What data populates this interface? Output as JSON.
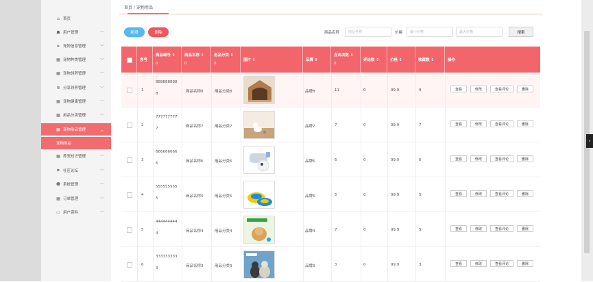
{
  "sidebar": {
    "items": [
      {
        "label": "首页",
        "icon": "home-icon",
        "glyph": "⌂",
        "chevron": false
      },
      {
        "label": "用户管理",
        "icon": "user-group-icon",
        "glyph": "☗",
        "chevron": true
      },
      {
        "label": "宠物信息管理",
        "icon": "paper-plane-icon",
        "glyph": "➤",
        "chevron": true
      },
      {
        "label": "宠物种类管理",
        "icon": "grid-icon",
        "glyph": "▦",
        "chevron": true
      },
      {
        "label": "宠物领养管理",
        "icon": "grid-icon",
        "glyph": "▦",
        "chevron": true
      },
      {
        "label": "分享领养管理",
        "icon": "database-icon",
        "glyph": "≣",
        "chevron": true
      },
      {
        "label": "宠物健康管理",
        "icon": "grid-icon",
        "glyph": "▦",
        "chevron": true
      },
      {
        "label": "用品分类管理",
        "icon": "grid-icon",
        "glyph": "▦",
        "chevron": true
      },
      {
        "label": "宠物用品管理",
        "icon": "grid-icon",
        "glyph": "▦",
        "chevron": true,
        "active": true
      },
      {
        "label": "养宠知识管理",
        "icon": "grid-icon",
        "glyph": "▦",
        "chevron": true
      },
      {
        "label": "社区论坛",
        "icon": "flag-icon",
        "glyph": "⚑",
        "chevron": true
      },
      {
        "label": "系统管理",
        "icon": "user-icon",
        "glyph": "☻",
        "chevron": true
      },
      {
        "label": "订单管理",
        "icon": "grid-icon",
        "glyph": "▦",
        "chevron": true
      },
      {
        "label": "用户资料",
        "icon": "id-card-icon",
        "glyph": "▭",
        "chevron": true
      }
    ],
    "sub_item": "宠物用品"
  },
  "breadcrumb": "首页 / 宠物用品",
  "toolbar": {
    "add_label": "新增",
    "delete_label": "删除",
    "search_label": "搜索"
  },
  "search": {
    "name_label": "商品名称",
    "name_placeholder": "商品名称",
    "price_label": "价格",
    "min_placeholder": "最小价格",
    "max_placeholder": "最大价格"
  },
  "table": {
    "headers": {
      "index": "序号",
      "code": "商品编号",
      "name": "商品名称",
      "category": "用品分类",
      "image": "图片",
      "brand": "品牌",
      "clicks": "点击次数",
      "comments": "评论数",
      "price": "价格",
      "favorites": "收藏数",
      "actions": "操作",
      "sort_mark": "0",
      "sort_arrow": "⇕"
    },
    "action_labels": {
      "view": "查看",
      "edit": "修改",
      "view_comments": "查看评论",
      "delete": "删除"
    },
    "rows": [
      {
        "index": "1",
        "code_line1": "888888888",
        "code_line2": "8",
        "name": "商品名称8",
        "category": "用品分类8",
        "brand": "品牌8",
        "clicks": "11",
        "comments": "0",
        "price": "99.9",
        "favorites": "9",
        "image": "pet-house"
      },
      {
        "index": "2",
        "code_line1": "777777777",
        "code_line2": "7",
        "name": "商品名称7",
        "category": "用品分类7",
        "brand": "品牌7",
        "clicks": "7",
        "comments": "0",
        "price": "99.9",
        "favorites": "7",
        "image": "dog-on-floor"
      },
      {
        "index": "3",
        "code_line1": "666666666",
        "code_line2": "6",
        "name": "商品名称6",
        "category": "用品分类6",
        "brand": "品牌6",
        "clicks": "6",
        "comments": "0",
        "price": "99.9",
        "favorites": "6",
        "image": "grooming-brush"
      },
      {
        "index": "4",
        "code_line1": "555555555",
        "code_line2": "5",
        "name": "商品名称5",
        "category": "用品分类5",
        "brand": "品牌5",
        "clicks": "5",
        "comments": "0",
        "price": "99.9",
        "favorites": "5",
        "image": "pet-bowls"
      },
      {
        "index": "5",
        "code_line1": "444444444",
        "code_line2": "4",
        "name": "商品名称4",
        "category": "用品分类4",
        "brand": "品牌4",
        "clicks": "7",
        "comments": "0",
        "price": "99.9",
        "favorites": "5",
        "image": "dog-toy-ad"
      },
      {
        "index": "6",
        "code_line1": "333333333",
        "code_line2": "3",
        "name": "商品名称3",
        "category": "用品分类3",
        "brand": "品牌3",
        "clicks": "3",
        "comments": "0",
        "price": "99.9",
        "favorites": "3",
        "image": "cat-and-dog"
      }
    ]
  },
  "colors": {
    "accent": "#f26b6f",
    "header": "#f2656b",
    "add": "#56b9ef",
    "delete": "#f2565a"
  }
}
